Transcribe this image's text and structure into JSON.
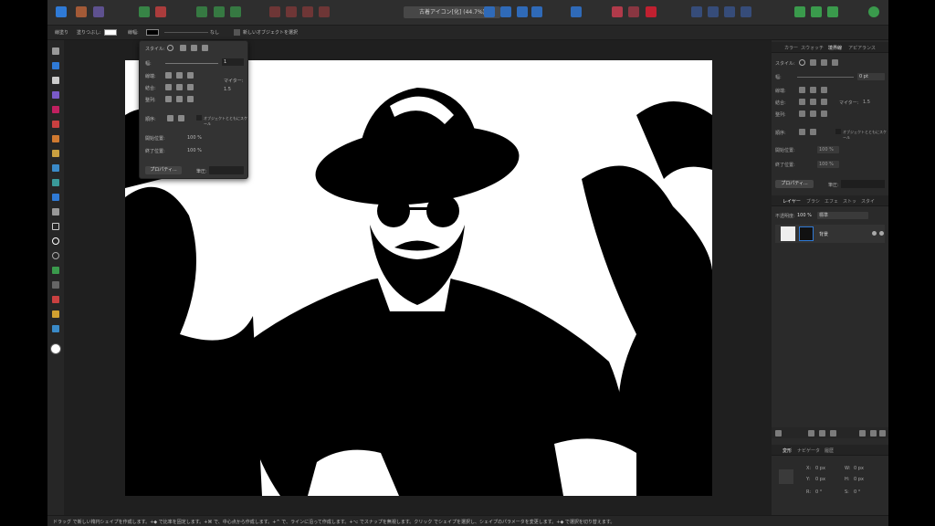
{
  "document": {
    "title": "古着アイコン[化] (44.7%)"
  },
  "colors": {
    "toolbar_bg": "#2e2e2e",
    "panel_bg": "#2a2a2a",
    "canvas_bg": "#1f1f1f",
    "accent_blue": "#2f7ad6",
    "accent_red": "#c94040",
    "accent_green": "#3a9a4c"
  },
  "contextbar": {
    "fill_label": "線塗り",
    "stroke_label": "塗りつぶし:",
    "line_label": "線幅:",
    "none_label": "なし",
    "new_object_label": "新しいオブジェクトを選択"
  },
  "stroke_popup": {
    "style_label": "スタイル:",
    "width_label": "幅:",
    "width_value": "1",
    "cap_label": "線端:",
    "join_label": "結合:",
    "align_label": "整列:",
    "miter_label": "マイター:",
    "miter_value": "1.5",
    "order_label": "順序:",
    "scale_label": "オブジェクトとともにスケール",
    "start_label": "開始位置:",
    "end_label": "終了位置:",
    "pct1": "100 %",
    "pct2": "100 %",
    "properties_button": "プロパティ...",
    "pressure_label": "筆圧:"
  },
  "right_panel": {
    "tabs_top": [
      "カラー",
      "スウォッチ",
      "境界線",
      "アピアランス"
    ],
    "active_tab_top": "境界線",
    "style_label": "スタイル:",
    "width_label": "幅:",
    "width_value": "0 pt",
    "cap_label": "線端:",
    "join_label": "結合:",
    "align_label": "整列:",
    "miter_label": "マイター:",
    "miter_value": "1.5",
    "order_label": "順序:",
    "scale_label": "オブジェクトとともにスケール",
    "start_label": "開始位置:",
    "end_label": "終了位置:",
    "pct1": "100 %",
    "pct2": "100 %",
    "properties_button": "プロパティ...",
    "pressure_label": "筆圧:",
    "tabs_mid": [
      "レイヤー",
      "ブラシ",
      "エフェ",
      "ストッ",
      "スタイ"
    ],
    "opacity_label": "不透明度:",
    "opacity_value": "100 %",
    "blend_mode": "標準",
    "layer_name": "背景",
    "tabs_bottom": [
      "変形",
      "ナビゲータ",
      "履歴"
    ],
    "x_label": "X:",
    "x_value": "0 px",
    "y_label": "Y:",
    "y_value": "0 px",
    "w_label": "W:",
    "w_value": "0 px",
    "h_label": "H:",
    "h_value": "0 px",
    "r_label": "R:",
    "r_value": "0 °",
    "s_label": "S:",
    "s_value": "0 °"
  },
  "statusbar": {
    "text": "ドラッグ で新しい楕円シェイプを作成します。+◆ で比率を固定します。+⌘ で、中心点から作成します。+^ で、ラインに沿って作成します。+⌥ でスナップを無視します。クリック でシェイプを選択し、シェイプのパラメータを変更します。+◆ で選択を切り替えます。"
  }
}
